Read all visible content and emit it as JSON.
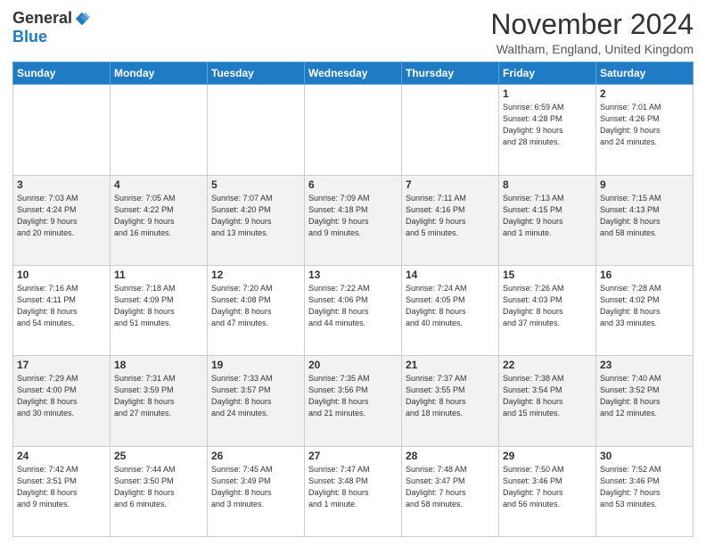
{
  "logo": {
    "general": "General",
    "blue": "Blue"
  },
  "title": "November 2024",
  "location": "Waltham, England, United Kingdom",
  "days_header": [
    "Sunday",
    "Monday",
    "Tuesday",
    "Wednesday",
    "Thursday",
    "Friday",
    "Saturday"
  ],
  "weeks": [
    [
      {
        "num": "",
        "detail": ""
      },
      {
        "num": "",
        "detail": ""
      },
      {
        "num": "",
        "detail": ""
      },
      {
        "num": "",
        "detail": ""
      },
      {
        "num": "",
        "detail": ""
      },
      {
        "num": "1",
        "detail": "Sunrise: 6:59 AM\nSunset: 4:28 PM\nDaylight: 9 hours\nand 28 minutes."
      },
      {
        "num": "2",
        "detail": "Sunrise: 7:01 AM\nSunset: 4:26 PM\nDaylight: 9 hours\nand 24 minutes."
      }
    ],
    [
      {
        "num": "3",
        "detail": "Sunrise: 7:03 AM\nSunset: 4:24 PM\nDaylight: 9 hours\nand 20 minutes."
      },
      {
        "num": "4",
        "detail": "Sunrise: 7:05 AM\nSunset: 4:22 PM\nDaylight: 9 hours\nand 16 minutes."
      },
      {
        "num": "5",
        "detail": "Sunrise: 7:07 AM\nSunset: 4:20 PM\nDaylight: 9 hours\nand 13 minutes."
      },
      {
        "num": "6",
        "detail": "Sunrise: 7:09 AM\nSunset: 4:18 PM\nDaylight: 9 hours\nand 9 minutes."
      },
      {
        "num": "7",
        "detail": "Sunrise: 7:11 AM\nSunset: 4:16 PM\nDaylight: 9 hours\nand 5 minutes."
      },
      {
        "num": "8",
        "detail": "Sunrise: 7:13 AM\nSunset: 4:15 PM\nDaylight: 9 hours\nand 1 minute."
      },
      {
        "num": "9",
        "detail": "Sunrise: 7:15 AM\nSunset: 4:13 PM\nDaylight: 8 hours\nand 58 minutes."
      }
    ],
    [
      {
        "num": "10",
        "detail": "Sunrise: 7:16 AM\nSunset: 4:11 PM\nDaylight: 8 hours\nand 54 minutes."
      },
      {
        "num": "11",
        "detail": "Sunrise: 7:18 AM\nSunset: 4:09 PM\nDaylight: 8 hours\nand 51 minutes."
      },
      {
        "num": "12",
        "detail": "Sunrise: 7:20 AM\nSunset: 4:08 PM\nDaylight: 8 hours\nand 47 minutes."
      },
      {
        "num": "13",
        "detail": "Sunrise: 7:22 AM\nSunset: 4:06 PM\nDaylight: 8 hours\nand 44 minutes."
      },
      {
        "num": "14",
        "detail": "Sunrise: 7:24 AM\nSunset: 4:05 PM\nDaylight: 8 hours\nand 40 minutes."
      },
      {
        "num": "15",
        "detail": "Sunrise: 7:26 AM\nSunset: 4:03 PM\nDaylight: 8 hours\nand 37 minutes."
      },
      {
        "num": "16",
        "detail": "Sunrise: 7:28 AM\nSunset: 4:02 PM\nDaylight: 8 hours\nand 33 minutes."
      }
    ],
    [
      {
        "num": "17",
        "detail": "Sunrise: 7:29 AM\nSunset: 4:00 PM\nDaylight: 8 hours\nand 30 minutes."
      },
      {
        "num": "18",
        "detail": "Sunrise: 7:31 AM\nSunset: 3:59 PM\nDaylight: 8 hours\nand 27 minutes."
      },
      {
        "num": "19",
        "detail": "Sunrise: 7:33 AM\nSunset: 3:57 PM\nDaylight: 8 hours\nand 24 minutes."
      },
      {
        "num": "20",
        "detail": "Sunrise: 7:35 AM\nSunset: 3:56 PM\nDaylight: 8 hours\nand 21 minutes."
      },
      {
        "num": "21",
        "detail": "Sunrise: 7:37 AM\nSunset: 3:55 PM\nDaylight: 8 hours\nand 18 minutes."
      },
      {
        "num": "22",
        "detail": "Sunrise: 7:38 AM\nSunset: 3:54 PM\nDaylight: 8 hours\nand 15 minutes."
      },
      {
        "num": "23",
        "detail": "Sunrise: 7:40 AM\nSunset: 3:52 PM\nDaylight: 8 hours\nand 12 minutes."
      }
    ],
    [
      {
        "num": "24",
        "detail": "Sunrise: 7:42 AM\nSunset: 3:51 PM\nDaylight: 8 hours\nand 9 minutes."
      },
      {
        "num": "25",
        "detail": "Sunrise: 7:44 AM\nSunset: 3:50 PM\nDaylight: 8 hours\nand 6 minutes."
      },
      {
        "num": "26",
        "detail": "Sunrise: 7:45 AM\nSunset: 3:49 PM\nDaylight: 8 hours\nand 3 minutes."
      },
      {
        "num": "27",
        "detail": "Sunrise: 7:47 AM\nSunset: 3:48 PM\nDaylight: 8 hours\nand 1 minute."
      },
      {
        "num": "28",
        "detail": "Sunrise: 7:48 AM\nSunset: 3:47 PM\nDaylight: 7 hours\nand 58 minutes."
      },
      {
        "num": "29",
        "detail": "Sunrise: 7:50 AM\nSunset: 3:46 PM\nDaylight: 7 hours\nand 56 minutes."
      },
      {
        "num": "30",
        "detail": "Sunrise: 7:52 AM\nSunset: 3:46 PM\nDaylight: 7 hours\nand 53 minutes."
      }
    ]
  ]
}
